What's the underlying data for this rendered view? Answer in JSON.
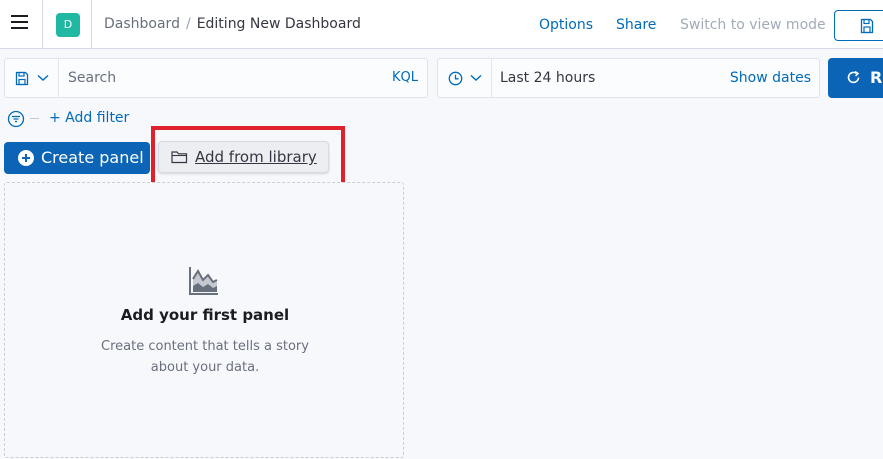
{
  "header": {
    "space_initial": "D",
    "breadcrumbs": [
      "Dashboard",
      "Editing New Dashboard"
    ],
    "links": {
      "options": "Options",
      "share": "Share",
      "switch_mode": "Switch to view mode"
    }
  },
  "query_bar": {
    "search_placeholder": "Search",
    "language": "KQL"
  },
  "date_picker": {
    "range": "Last 24 hours",
    "show_dates": "Show dates"
  },
  "refresh": {
    "label": "Re"
  },
  "filters": {
    "add_filter": "+ Add filter"
  },
  "toolbar": {
    "create_panel": "Create panel",
    "add_from_library": "Add from library"
  },
  "empty_state": {
    "title": "Add your first panel",
    "body": "Create content that tells a story about your data."
  },
  "colors": {
    "primary": "#0b64b5",
    "link": "#006bb8",
    "space_avatar": "#20b8a3",
    "highlight": "#e0202a"
  },
  "icons": [
    "menu-icon",
    "save-icon",
    "saved-query-icon",
    "chevron-down-icon",
    "clock-icon",
    "refresh-icon",
    "filter-options-icon",
    "plus-circle-icon",
    "folder-icon",
    "area-chart-icon"
  ]
}
